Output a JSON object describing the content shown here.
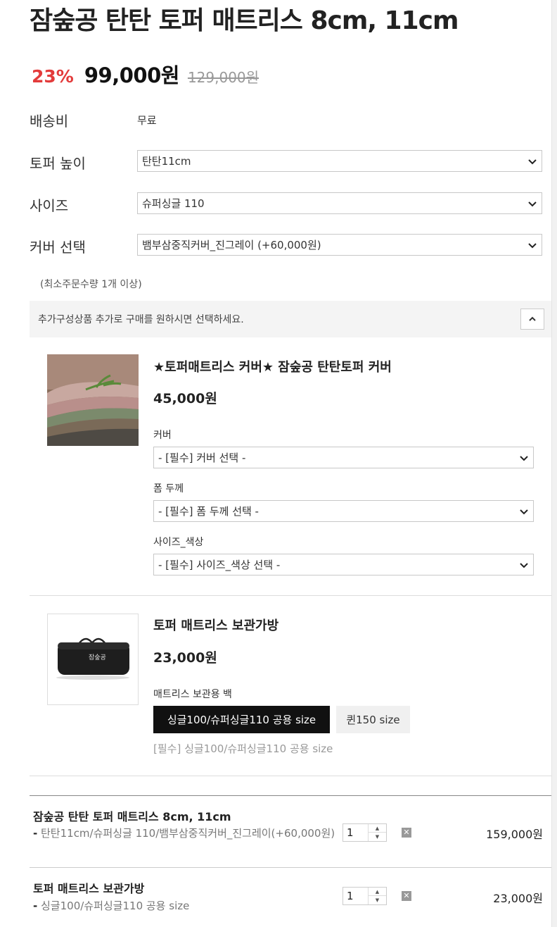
{
  "product": {
    "title": "잠숲공 탄탄 토퍼 매트리스 8cm, 11cm",
    "discount": "23%",
    "price": "99,000원",
    "original_price": "129,000원"
  },
  "options": {
    "shipping_label": "배송비",
    "shipping_value": "무료",
    "height_label": "토퍼 높이",
    "height_value": "탄탄11cm",
    "size_label": "사이즈",
    "size_value": "슈퍼싱글 110",
    "cover_label": "커버 선택",
    "cover_value": "뱀부삼중직커버_진그레이 (+60,000원)",
    "min_qty": "(최소주문수량 1개 이상)"
  },
  "additional": {
    "bar_text": "추가구성상품 추가로 구매를 원하시면 선택하세요.",
    "items": [
      {
        "title": "★토퍼매트리스 커버★ 잠숲공 탄탄토퍼 커버",
        "price": "45,000원",
        "opt1_label": "커버",
        "opt1_value": "- [필수] 커버 선택 -",
        "opt2_label": "폼 두께",
        "opt2_value": "- [필수] 폼 두께 선택 -",
        "opt3_label": "사이즈_색상",
        "opt3_value": "- [필수] 사이즈_색상 선택 -"
      },
      {
        "title": "토퍼 매트리스 보관가방",
        "price": "23,000원",
        "opt_label": "매트리스 보관용 백",
        "sizes": [
          "싱글100/슈퍼싱글110 공용 size",
          "퀸150 size"
        ],
        "required_note": "[필수] 싱글100/슈퍼싱글110 공용 size",
        "bag_logo": "잠숲공"
      }
    ]
  },
  "selected": [
    {
      "name": "잠숲공 탄탄 토퍼 매트리스 8cm, 11cm",
      "dash": "-",
      "option": " 탄탄11cm/슈퍼싱글 110/뱀부삼중직커버_진그레이(+60,000원)",
      "qty": "1",
      "price": "159,000원"
    },
    {
      "name": "토퍼 매트리스 보관가방",
      "dash": "-",
      "option": " 싱글100/슈퍼싱글110 공용 size",
      "qty": "1",
      "price": "23,000원"
    }
  ],
  "colors": {
    "discount": "#e33b3b",
    "active_btn": "#111111"
  }
}
